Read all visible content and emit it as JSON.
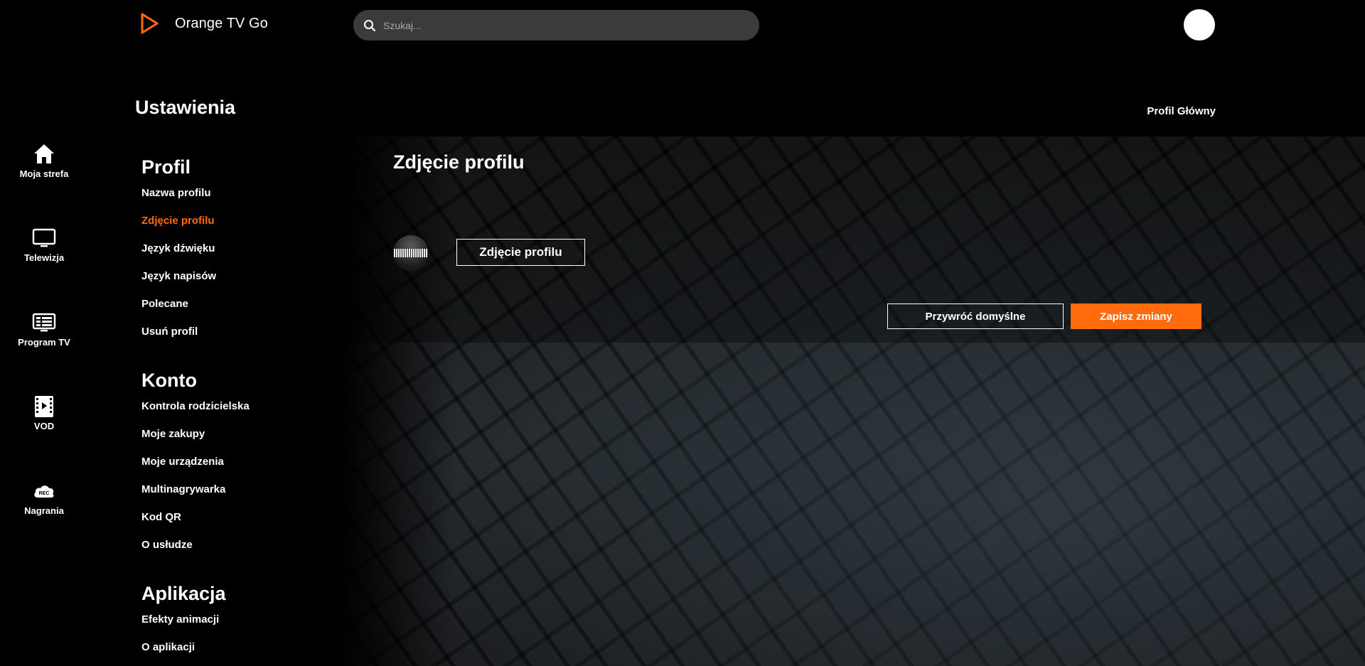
{
  "header": {
    "app_title": "Orange TV Go",
    "search_placeholder": "Szukaj..."
  },
  "rail": {
    "items": [
      {
        "label": "Moja strefa",
        "icon": "home-icon"
      },
      {
        "label": "Telewizja",
        "icon": "tv-icon"
      },
      {
        "label": "Program TV",
        "icon": "tv-guide-icon"
      },
      {
        "label": "VOD",
        "icon": "film-icon"
      },
      {
        "label": "Nagrania",
        "icon": "rec-cloud-icon"
      }
    ]
  },
  "settings": {
    "title": "Ustawienia",
    "profile_name": "Profil Główny",
    "sections": [
      {
        "title": "Profil",
        "items": [
          "Nazwa profilu",
          "Zdjęcie profilu",
          "Język dźwięku",
          "Język napisów",
          "Polecane",
          "Usuń profil"
        ]
      },
      {
        "title": "Konto",
        "items": [
          "Kontrola rodzicielska",
          "Moje zakupy",
          "Moje urządzenia",
          "Multinagrywarka",
          "Kod QR",
          "O usłudze"
        ]
      },
      {
        "title": "Aplikacja",
        "items": [
          "Efekty animacji",
          "O aplikacji"
        ]
      }
    ],
    "active_item": "Zdjęcie profilu"
  },
  "content": {
    "title": "Zdjęcie profilu",
    "change_button": "Zdjęcie profilu",
    "restore_button": "Przywróć domyślne",
    "save_button": "Zapisz zmiany"
  },
  "colors": {
    "accent": "#ff6b0d",
    "background": "#000000",
    "search_bg": "#3b3b3b"
  }
}
